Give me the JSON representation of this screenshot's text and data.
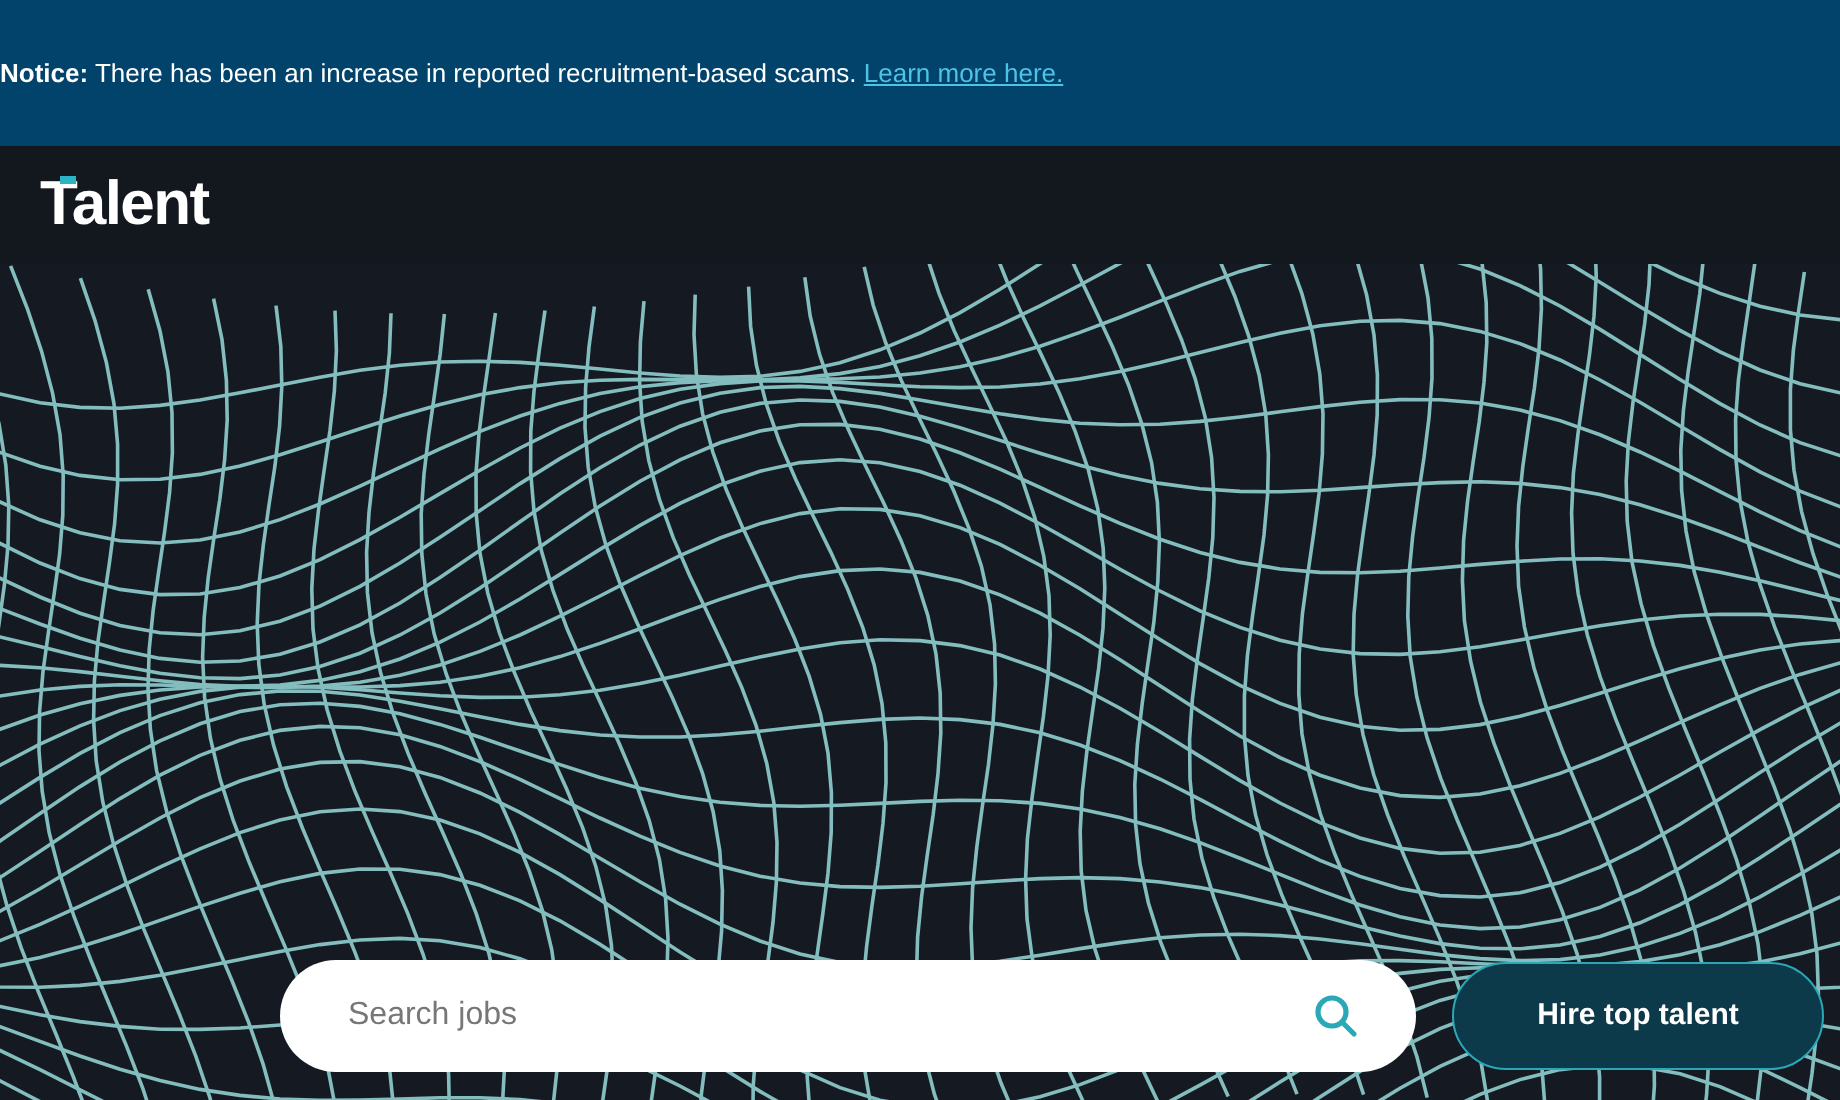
{
  "notice": {
    "label": "Notice:",
    "text": "There has been an increase in reported recruitment-based scams.",
    "link": "Learn more here."
  },
  "logo": {
    "text": "Talent"
  },
  "search": {
    "placeholder": "Search jobs"
  },
  "hire_button": {
    "label": "Hire top talent"
  }
}
